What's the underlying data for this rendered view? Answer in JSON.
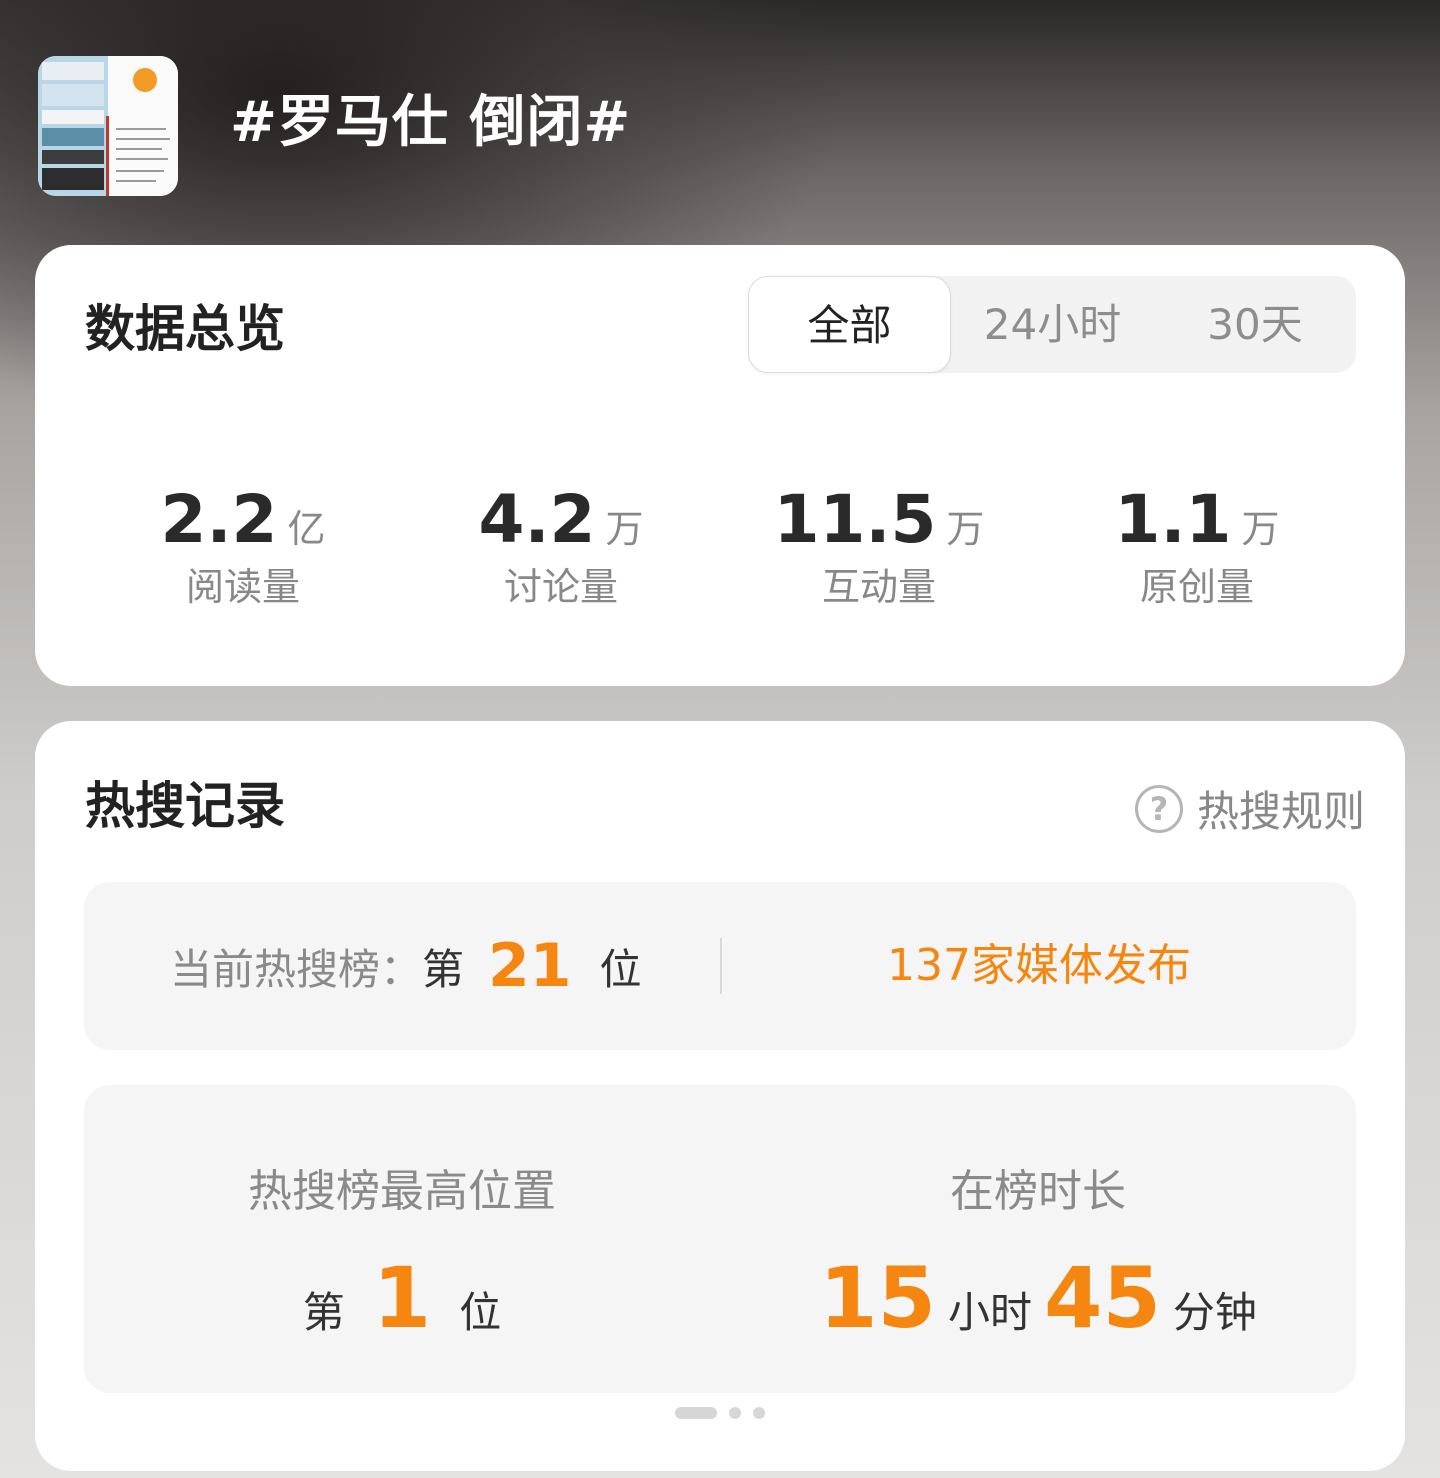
{
  "header": {
    "topic_title": "#罗马仕 倒闭#",
    "thumbnail_icon": "topic-thumbnail-image"
  },
  "overview": {
    "title": "数据总览",
    "tabs": [
      {
        "label": "全部",
        "active": true
      },
      {
        "label": "24小时",
        "active": false
      },
      {
        "label": "30天",
        "active": false
      }
    ],
    "stats": [
      {
        "value": "2.2",
        "unit": "亿",
        "label": "阅读量"
      },
      {
        "value": "4.2",
        "unit": "万",
        "label": "讨论量"
      },
      {
        "value": "11.5",
        "unit": "万",
        "label": "互动量"
      },
      {
        "value": "1.1",
        "unit": "万",
        "label": "原创量"
      }
    ]
  },
  "hot_search": {
    "title": "热搜记录",
    "rules_label": "热搜规则",
    "rules_icon": "question-circle-icon",
    "current": {
      "label": "当前热搜榜：",
      "rank_prefix": "第",
      "rank": "21",
      "rank_suffix": "位",
      "media_text": "137家媒体发布"
    },
    "record": {
      "highest_title": "热搜榜最高位置",
      "highest_prefix": "第",
      "highest_rank": "1",
      "highest_suffix": "位",
      "duration_title": "在榜时长",
      "hours": "15",
      "hours_unit": "小时",
      "minutes": "45",
      "minutes_unit": "分钟"
    },
    "pager": {
      "pages": 3,
      "active": 1
    }
  },
  "colors": {
    "accent": "#f5860f",
    "text_primary": "#222222",
    "text_secondary": "#888888",
    "panel_bg": "#f5f5f5"
  }
}
